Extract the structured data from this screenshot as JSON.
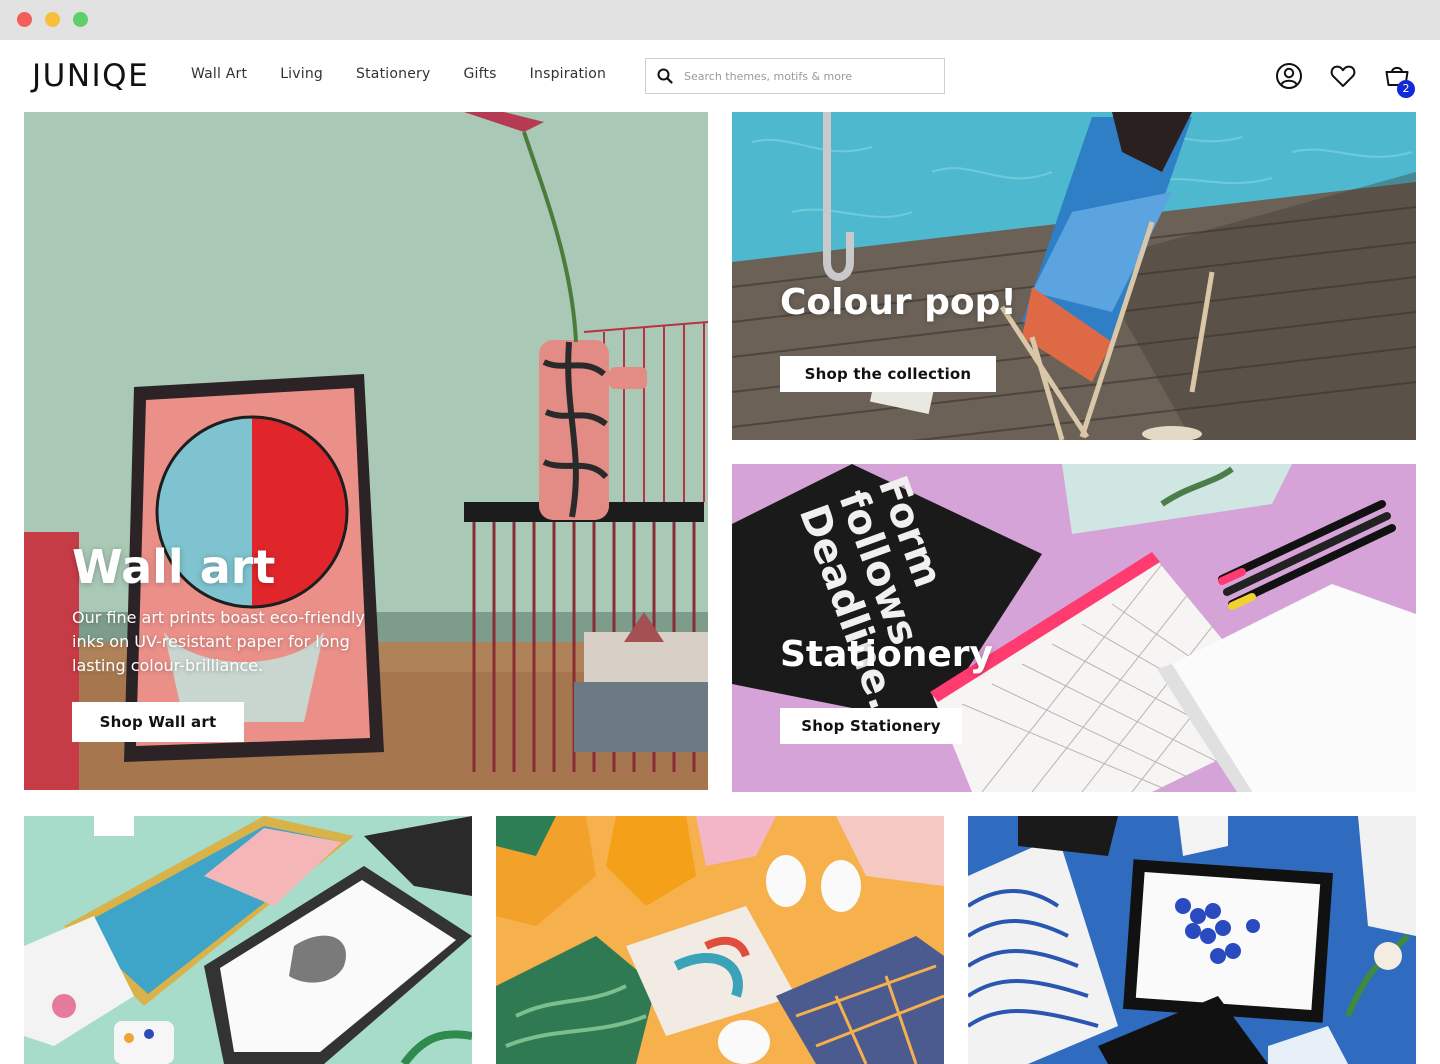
{
  "header": {
    "logo": "JUNIQE",
    "nav": [
      "Wall Art",
      "Living",
      "Stationery",
      "Gifts",
      "Inspiration"
    ],
    "search_placeholder": "Search themes, motifs & more",
    "cart_count": "2",
    "icons": [
      "account-icon",
      "heart-icon",
      "cart-icon"
    ]
  },
  "tiles": {
    "wall_art": {
      "title": "Wall art",
      "description_lines": [
        "Our fine art prints boast eco-friendly",
        "inks on UV-resistant paper for long",
        "lasting colour-brilliance."
      ],
      "button": "Shop Wall art"
    },
    "colour_pop": {
      "title": "Colour pop!",
      "button": "Shop the collection"
    },
    "stationery": {
      "title": "Stationery",
      "button": "Shop Stationery",
      "notebook_text": [
        "Form",
        "follows",
        "Deadline."
      ]
    }
  },
  "colors": {
    "brand": "#111111",
    "badge": "#1129d6",
    "wall_bg": "#a9c6b4",
    "pool": "#49b8cf",
    "stationery_bg": "#d8a6d8",
    "mint": "#a6dccb",
    "orange": "#f7b04a",
    "blue": "#2b6bc0"
  }
}
